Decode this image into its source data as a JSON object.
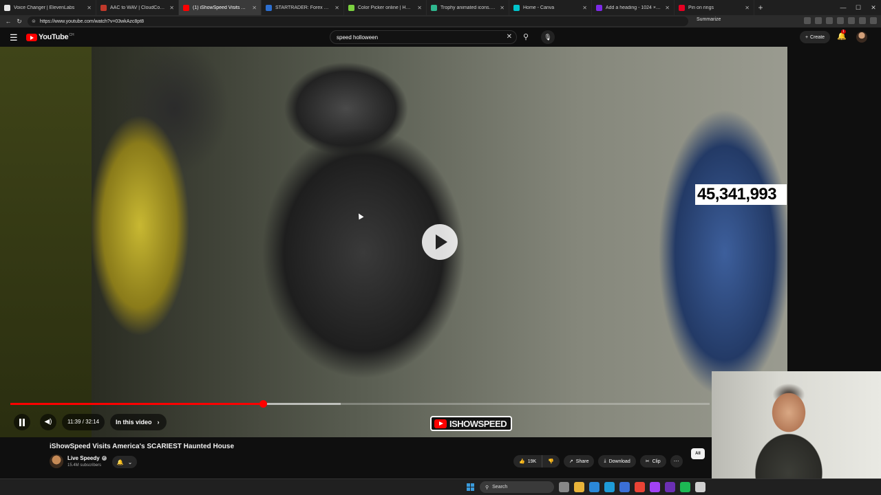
{
  "browser": {
    "tabs": [
      {
        "title": "Voice Changer | ElevenLabs",
        "color": "#e8e8e8"
      },
      {
        "title": "AAC to WAV | CloudConvert",
        "color": "#c0392b"
      },
      {
        "title": "(1) iShowSpeed Visits Ameri",
        "color": "#ff0000"
      },
      {
        "title": "STARTRADER: Forex & CFD Tradi",
        "color": "#2c6fd1"
      },
      {
        "title": "Color Picker online | HEX Colo",
        "color": "#7bd13f"
      },
      {
        "title": "Trophy animated icons. Downlo",
        "color": "#2fb88f"
      },
      {
        "title": "Home - Canva",
        "color": "#00c4cc"
      },
      {
        "title": "Add a heading - 1024 × 1024px",
        "color": "#7d2ae8"
      },
      {
        "title": "Pin on rings",
        "color": "#e60023"
      }
    ],
    "url": "https://www.youtube.com/watch?v=03wkAzc8pt8",
    "summarize_label": "Summarize"
  },
  "youtube": {
    "logo_text": "YouTube",
    "logo_country": "CH",
    "search_query": "speed holloween",
    "create_label": "Create",
    "notification_count": "1"
  },
  "video": {
    "overlay_counter": "45,341,993",
    "watermark_text": "ISHOWSPEED",
    "current_time": "11:39",
    "duration": "32:14",
    "time_display": "11:39 / 32:14",
    "progress_fraction": 0.3613,
    "buffered_fraction": 0.4724,
    "chapters_label": "In this video",
    "title": "iShowSpeed Visits America's SCARIEST Haunted House"
  },
  "channel": {
    "name": "Live Speedy",
    "subscribers": "15.4M subscribers"
  },
  "actions": {
    "likes": "19K",
    "share": "Share",
    "download": "Download",
    "clip": "Clip"
  },
  "filter_chip": "All",
  "taskbar": {
    "search_label": "Search",
    "icon_colors": [
      "#888888",
      "#e8b339",
      "#2b88d8",
      "#1e9bd7",
      "#3b6fd6",
      "#ea4335",
      "#a142f4",
      "#6b2fb3",
      "#1db954",
      "#cfcfcf"
    ]
  }
}
